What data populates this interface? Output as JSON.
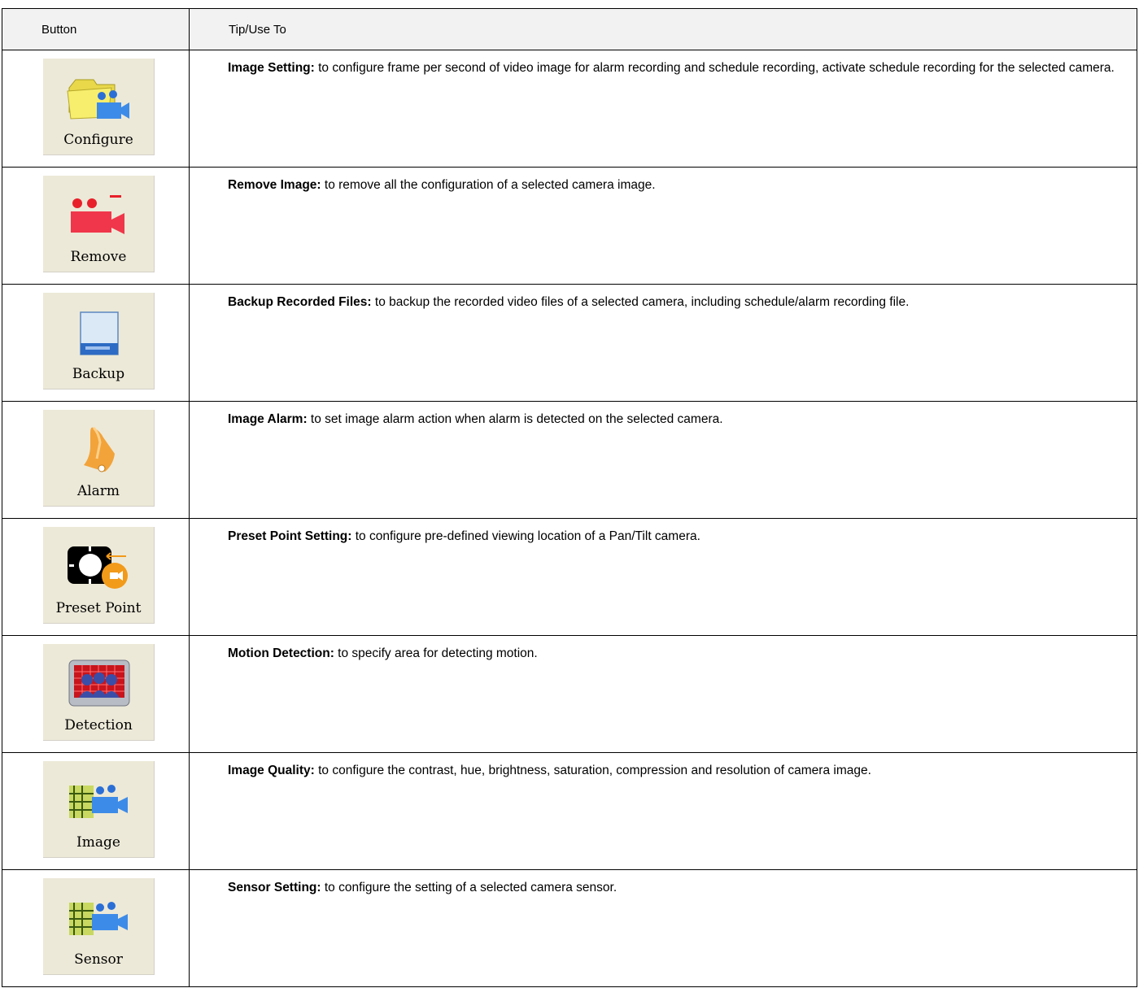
{
  "header": {
    "col_button": "Button",
    "col_tip": "Tip/Use To"
  },
  "rows": [
    {
      "icon": "configure-icon",
      "label": "Configure",
      "title": "Image Setting:",
      "text": " to configure frame per second of video image for alarm recording and schedule recording, activate schedule recording for the selected camera."
    },
    {
      "icon": "remove-camera-icon",
      "label": "Remove",
      "title": "Remove Image:",
      "text": " to remove all the configuration of a selected camera image."
    },
    {
      "icon": "backup-disk-icon",
      "label": "Backup",
      "title": "Backup Recorded Files:",
      "text": " to backup the recorded video files of a selected camera, including schedule/alarm recording file."
    },
    {
      "icon": "alarm-bell-icon",
      "label": "Alarm",
      "title": "Image Alarm:",
      "text": " to set image alarm action when alarm is detected on the selected camera."
    },
    {
      "icon": "preset-point-icon",
      "label": "Preset Point",
      "title": "Preset Point Setting:",
      "text": " to configure pre-defined viewing location of a Pan/Tilt camera."
    },
    {
      "icon": "motion-detection-icon",
      "label": "Detection",
      "title": "Motion Detection:",
      "text": " to specify area for detecting motion."
    },
    {
      "icon": "image-quality-icon",
      "label": "Image",
      "title": "Image Quality:",
      "text": " to configure the contrast, hue, brightness, saturation, compression and resolution of camera image."
    },
    {
      "icon": "sensor-icon",
      "label": "Sensor",
      "title": "Sensor Setting:",
      "text": " to configure the setting of a selected camera sensor."
    }
  ]
}
